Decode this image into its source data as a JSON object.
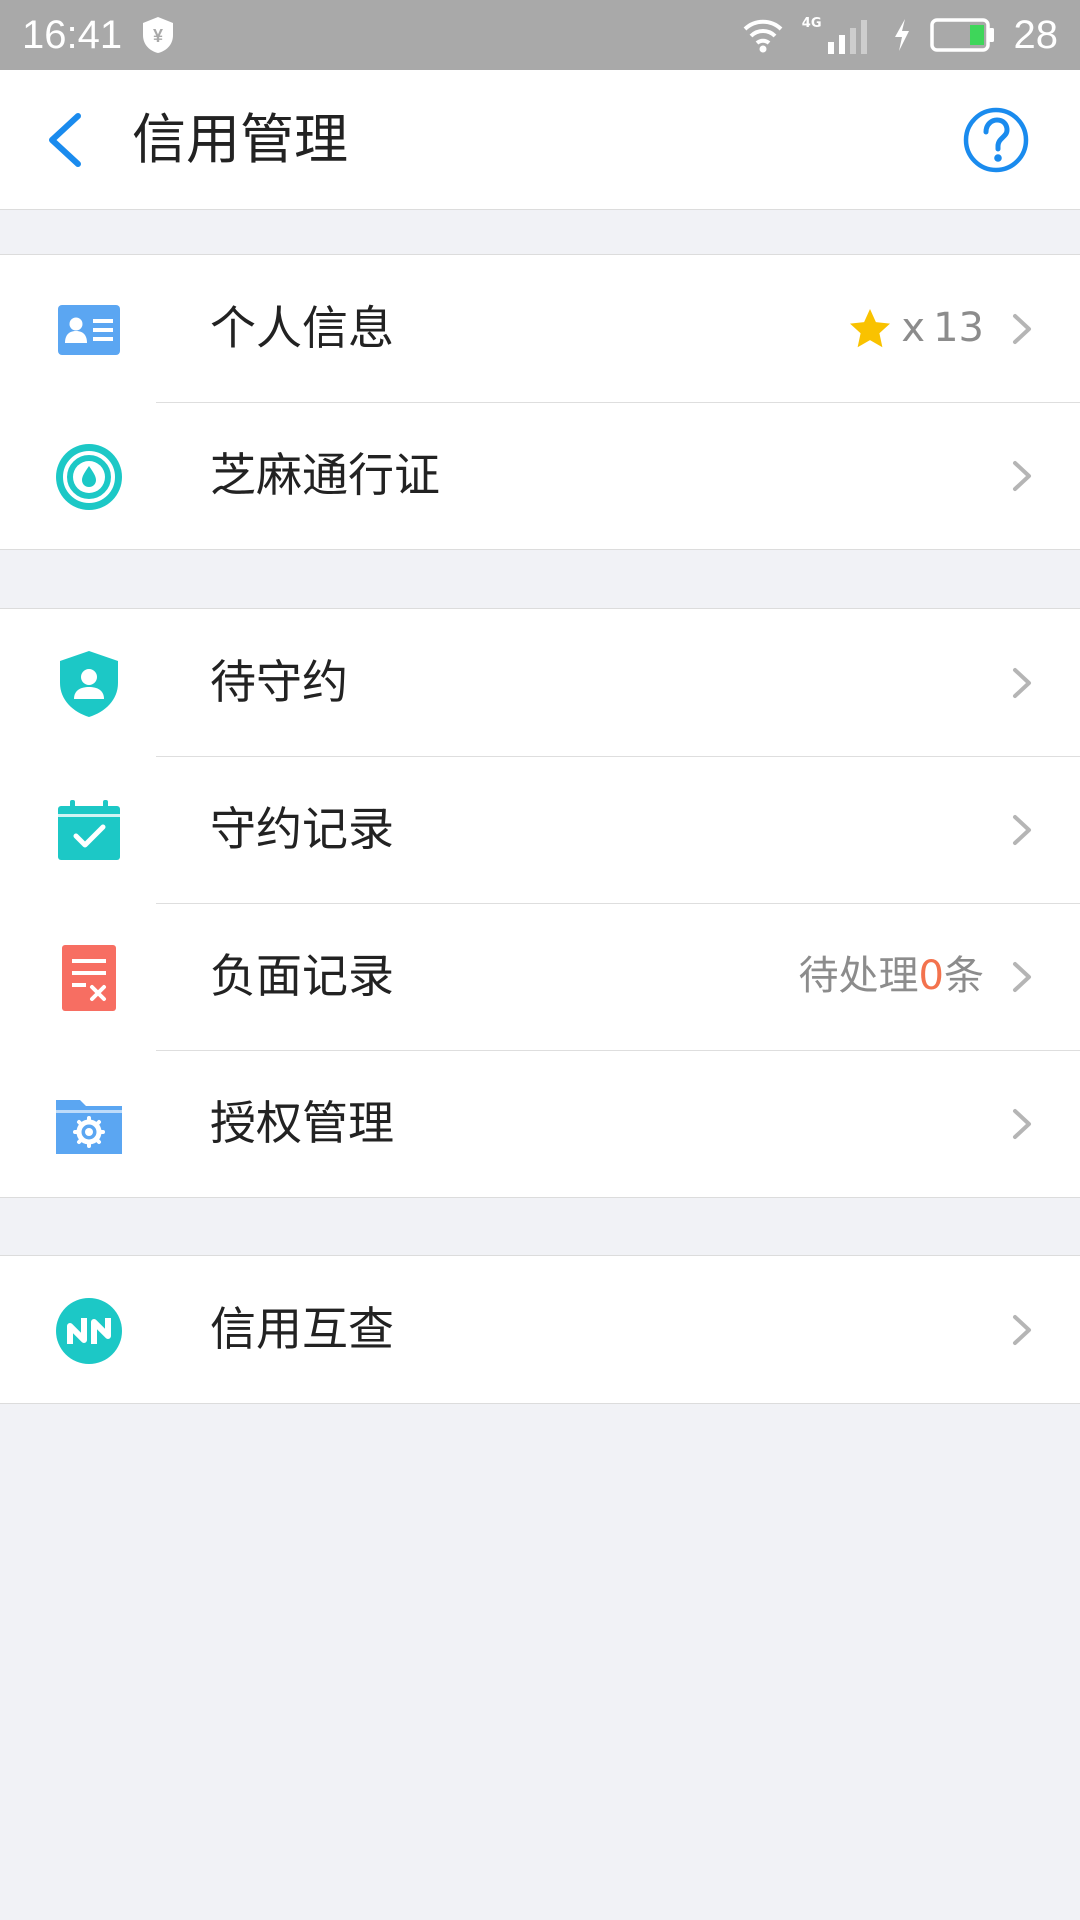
{
  "status_bar": {
    "time": "16:41",
    "network": "4G",
    "battery": "28"
  },
  "nav": {
    "title": "信用管理",
    "back_icon": "back-chevron-icon",
    "help_icon": "help-circle-icon"
  },
  "colors": {
    "accent_blue": "#1a8bee",
    "teal": "#1cc8c6",
    "red": "#f76e62",
    "star_yellow": "#f9c200",
    "orange_number": "#f3724d"
  },
  "groups": [
    {
      "items": [
        {
          "label": "个人信息",
          "icon": "id-card-icon",
          "extra": {
            "prefix": "x",
            "count": "13"
          }
        },
        {
          "label": "芝麻通行证",
          "icon": "sesame-pass-icon"
        }
      ]
    },
    {
      "items": [
        {
          "label": "待守约",
          "icon": "shield-user-icon"
        },
        {
          "label": "守约记录",
          "icon": "calendar-check-icon"
        },
        {
          "label": "负面记录",
          "icon": "negative-record-icon",
          "extra": {
            "before": "待处理",
            "number": "0",
            "after": "条"
          }
        },
        {
          "label": "授权管理",
          "icon": "folder-gear-icon"
        }
      ]
    },
    {
      "items": [
        {
          "label": "信用互查",
          "icon": "credit-check-icon"
        }
      ]
    }
  ]
}
